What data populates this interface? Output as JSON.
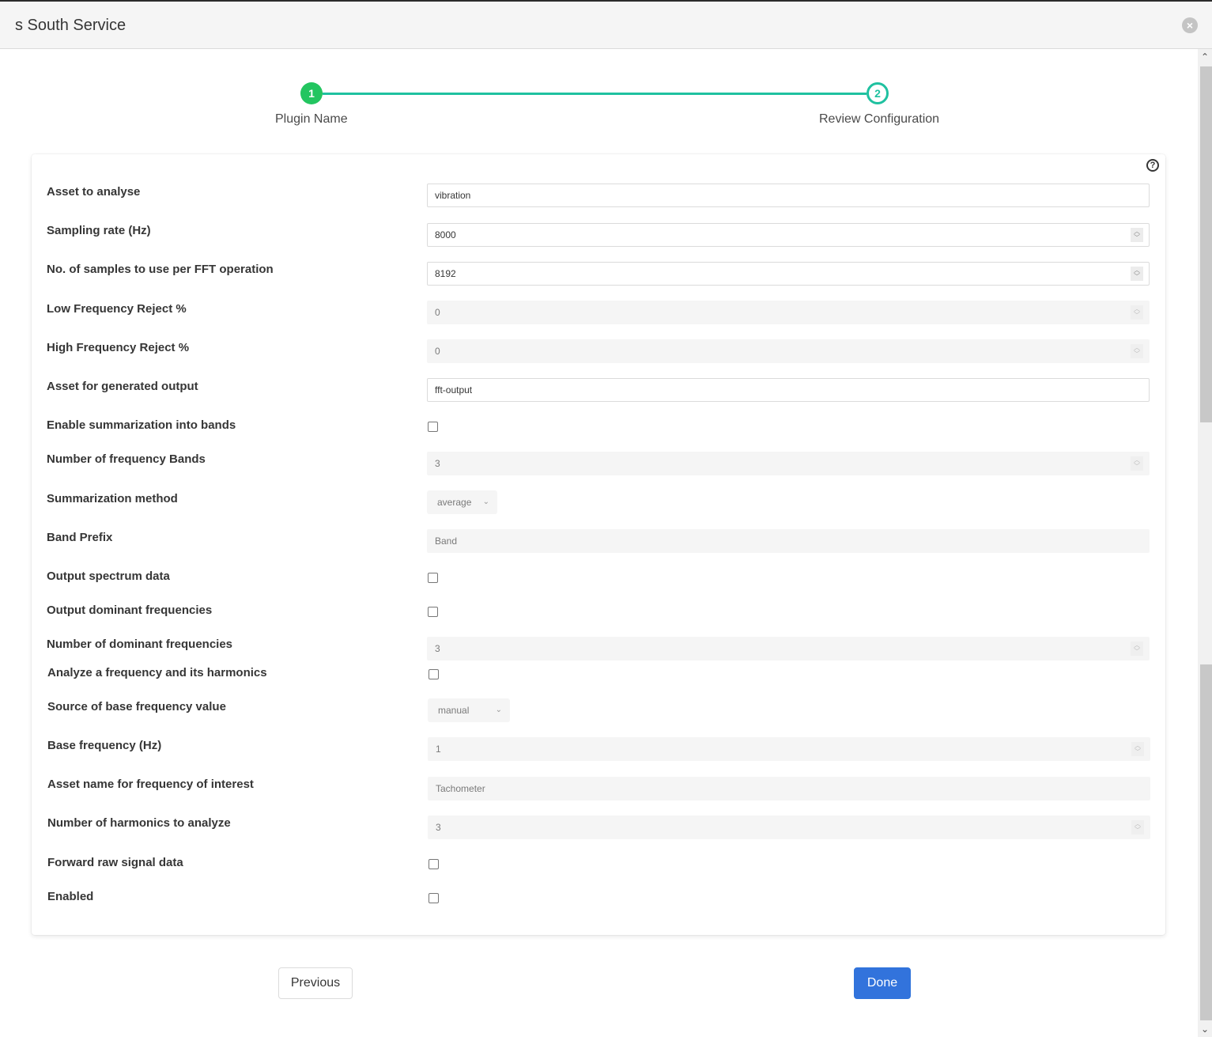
{
  "modal": {
    "title": "s South Service",
    "close_icon": "close-circle-icon"
  },
  "steps": [
    {
      "number": "1",
      "label": "Plugin Name",
      "state": "complete"
    },
    {
      "number": "2",
      "label": "Review Configuration",
      "state": "active"
    }
  ],
  "colors": {
    "step_complete": "#23c560",
    "step_active": "#1fc1a0",
    "primary_button": "#3273dc"
  },
  "config": {
    "help_icon": "question-circle-icon",
    "fields": [
      {
        "label": "Asset to analyse",
        "type": "text",
        "value": "vibration",
        "disabled": false
      },
      {
        "label": "Sampling rate (Hz)",
        "type": "number",
        "value": "8000",
        "disabled": false
      },
      {
        "label": "No. of samples to use per FFT operation",
        "type": "number",
        "value": "8192",
        "disabled": false
      },
      {
        "label": "Low Frequency Reject %",
        "type": "number",
        "value": "0",
        "disabled": true
      },
      {
        "label": "High Frequency Reject %",
        "type": "number",
        "value": "0",
        "disabled": true
      },
      {
        "label": "Asset for generated output",
        "type": "text",
        "value": "fft-output",
        "disabled": false
      },
      {
        "label": "Enable summarization into bands",
        "type": "checkbox",
        "checked": false
      },
      {
        "label": "Number of frequency Bands",
        "type": "number",
        "value": "3",
        "disabled": true
      },
      {
        "label": "Summarization method",
        "type": "select",
        "value": "average",
        "disabled": true
      },
      {
        "label": "Band Prefix",
        "type": "text",
        "value": "Band",
        "disabled": true
      },
      {
        "label": "Output spectrum data",
        "type": "checkbox",
        "checked": false
      },
      {
        "label": "Output dominant frequencies",
        "type": "checkbox",
        "checked": false
      },
      {
        "label": "Number of dominant frequencies",
        "type": "number",
        "value": "3",
        "disabled": true
      },
      {
        "label": "Analyze a frequency and its harmonics",
        "type": "checkbox",
        "checked": false
      },
      {
        "label": "Source of base frequency value",
        "type": "select",
        "value": "manual",
        "disabled": true
      },
      {
        "label": "Base frequency (Hz)",
        "type": "number",
        "value": "1",
        "disabled": true
      },
      {
        "label": "Asset name for frequency of interest",
        "type": "text",
        "value": "Tachometer",
        "disabled": true
      },
      {
        "label": "Number of harmonics to analyze",
        "type": "number",
        "value": "3",
        "disabled": true
      },
      {
        "label": "Forward raw signal data",
        "type": "checkbox",
        "checked": false
      },
      {
        "label": "Enabled",
        "type": "checkbox",
        "checked": false
      }
    ]
  },
  "footer": {
    "previous_label": "Previous",
    "done_label": "Done"
  }
}
